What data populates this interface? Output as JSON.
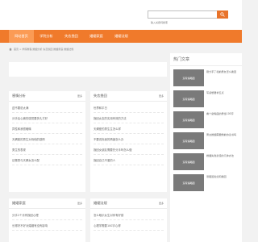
{
  "search": {
    "placeholder": "输入关键词搜索"
  },
  "nav": {
    "items": [
      {
        "label": "网站首页",
        "active": true
      },
      {
        "label": "学院分析",
        "active": false
      },
      {
        "label": "失恋挽回",
        "active": false
      },
      {
        "label": "婚姻家庭",
        "active": false
      },
      {
        "label": "婚姻法规",
        "active": false
      }
    ]
  },
  "breadcrumb": "首页 > 学院教程 婚姻分析 失恋挽回 婚姻家庭 婚姻法规",
  "sections": [
    {
      "title": "感情分析",
      "more": "更多",
      "items": [
        "送不要说太满",
        "分手后心痛的感觉要多久才好",
        "异性和我很暧昧",
        "天蝎座的男生对待他的感情",
        "男生的表现",
        "巨蟹男与天蝎女怎么配"
      ]
    },
    {
      "title": "失恋挽回",
      "more": "更多",
      "items": [
        "世界和平日",
        "挽回女友的实用有效的方法",
        "天蝎座的男生生怎么样",
        "不要说负面的情绪怎么办",
        "挽回女朋友需要先分手吗怎么做",
        "挽回自己不爱的人"
      ]
    },
    {
      "title": "婚姻家庭",
      "more": "更多",
      "items": [
        "分手2个月有挽回心理",
        "长得好不好对婚姻有没有影响"
      ]
    },
    {
      "title": "婚姻法规",
      "more": "更多",
      "items": [
        "怎么暗示女生对你有好感",
        "心理学需要100字心得"
      ]
    }
  ],
  "hot": {
    "title": "热门文章",
    "items": [
      {
        "thumb": "没有缩略图",
        "text": "刚分手了和前男友怎么挽回"
      },
      {
        "thumb": "没有缩略图",
        "text": "写感想要求五点"
      },
      {
        "thumb": "没有缩略图",
        "text": "看个摩羯座的男性100字"
      },
      {
        "thumb": "没有缩略图",
        "text": "男女婚姻需要婚前协议书吗"
      },
      {
        "thumb": "没有缩略图",
        "text": "婚姻失败最佳的几种办法"
      },
      {
        "thumb": "没有缩略图",
        "text": "暴瘦闺蜜如何挽回"
      }
    ]
  },
  "colors": {
    "accent": "#f07a2b",
    "nav_active": "#fb9b55",
    "thumb": "#7a7a7a"
  }
}
